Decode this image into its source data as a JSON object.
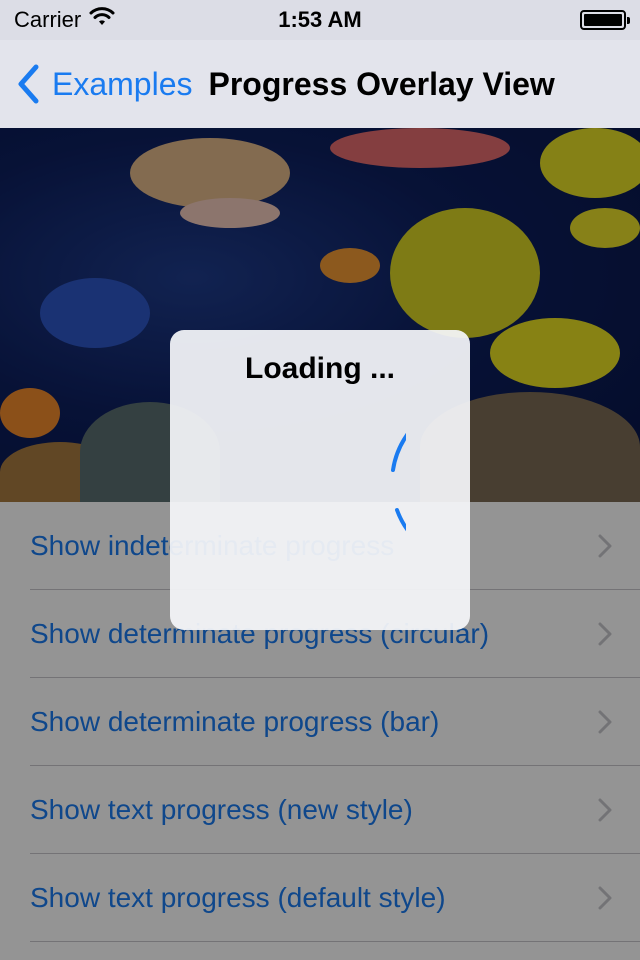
{
  "status_bar": {
    "carrier": "Carrier",
    "time": "1:53 AM",
    "wifi_icon": "wifi-icon",
    "battery_icon": "battery-icon"
  },
  "nav": {
    "back_label": "Examples",
    "title": "Progress Overlay View"
  },
  "hero": {
    "description_icon": "aquarium-image"
  },
  "rows": [
    {
      "label": "Show indeterminate progress"
    },
    {
      "label": "Show determinate progress (circular)"
    },
    {
      "label": "Show determinate progress (bar)"
    },
    {
      "label": "Show text progress (new style)"
    },
    {
      "label": "Show text progress (default style)"
    }
  ],
  "overlay": {
    "title": "Loading ...",
    "spinner_icon": "activity-spinner-icon"
  },
  "colors": {
    "accent": "#1a7bf0",
    "separator": "#c8c7cc",
    "nav_background": "#e3e4ec"
  }
}
